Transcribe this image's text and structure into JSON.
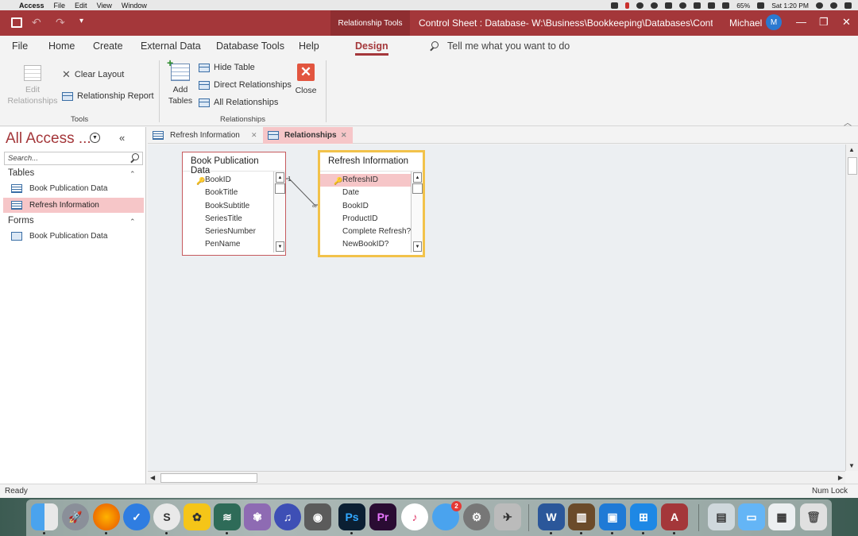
{
  "mac_menu": {
    "app": "Access",
    "items": [
      "File",
      "Edit",
      "View",
      "Window"
    ],
    "battery": "65%",
    "clock": "Sat 1:20 PM"
  },
  "titlebar": {
    "context_tab": "Relationship Tools",
    "title": "Control Sheet : Database- W:\\Business\\Bookkeeping\\Databases\\Control Sh...",
    "user": "Michael",
    "avatar_initial": "M",
    "minimize": "—",
    "restore": "❐",
    "close": "✕"
  },
  "ribbon_tabs": {
    "file": "File",
    "home": "Home",
    "create": "Create",
    "external": "External Data",
    "database_tools": "Database Tools",
    "help": "Help",
    "design": "Design",
    "tell_me": "Tell me what you want to do"
  },
  "ribbon": {
    "edit_relationships_l1": "Edit",
    "edit_relationships_l2": "Relationships",
    "clear_layout": "Clear Layout",
    "relationship_report": "Relationship Report",
    "tools_group": "Tools",
    "add_tables_l1": "Add",
    "add_tables_l2": "Tables",
    "hide_table": "Hide Table",
    "direct_relationships": "Direct Relationships",
    "all_relationships": "All Relationships",
    "close": "Close",
    "relationships_group": "Relationships"
  },
  "nav": {
    "title": "All Access ...",
    "search_placeholder": "Search...",
    "tables_label": "Tables",
    "tables": [
      "Book Publication Data",
      "Refresh Information"
    ],
    "forms_label": "Forms",
    "forms": [
      "Book Publication Data"
    ]
  },
  "doc_tabs": {
    "tab1": "Refresh Information",
    "tab2": "Relationships"
  },
  "field_lists": {
    "book": {
      "title": "Book Publication Data",
      "fields": [
        "BookID",
        "BookTitle",
        "BookSubtitle",
        "SeriesTitle",
        "SeriesNumber",
        "PenName"
      ]
    },
    "refresh": {
      "title": "Refresh Information",
      "fields": [
        "RefreshID",
        "Date",
        "BookID",
        "ProductID",
        "Complete Refresh?",
        "NewBookID?"
      ]
    },
    "relationship": {
      "one_side": "1",
      "many_side": "∞"
    }
  },
  "status": {
    "left": "Ready",
    "right": "Num Lock"
  },
  "dock": {
    "photoshop": "Ps",
    "premiere": "Pr",
    "word": "W",
    "access": "A",
    "messages_badge": "2"
  },
  "colors": {
    "accent": "#a4373a",
    "selection": "#f6c6c8",
    "table_highlight": "#f2c24a"
  }
}
